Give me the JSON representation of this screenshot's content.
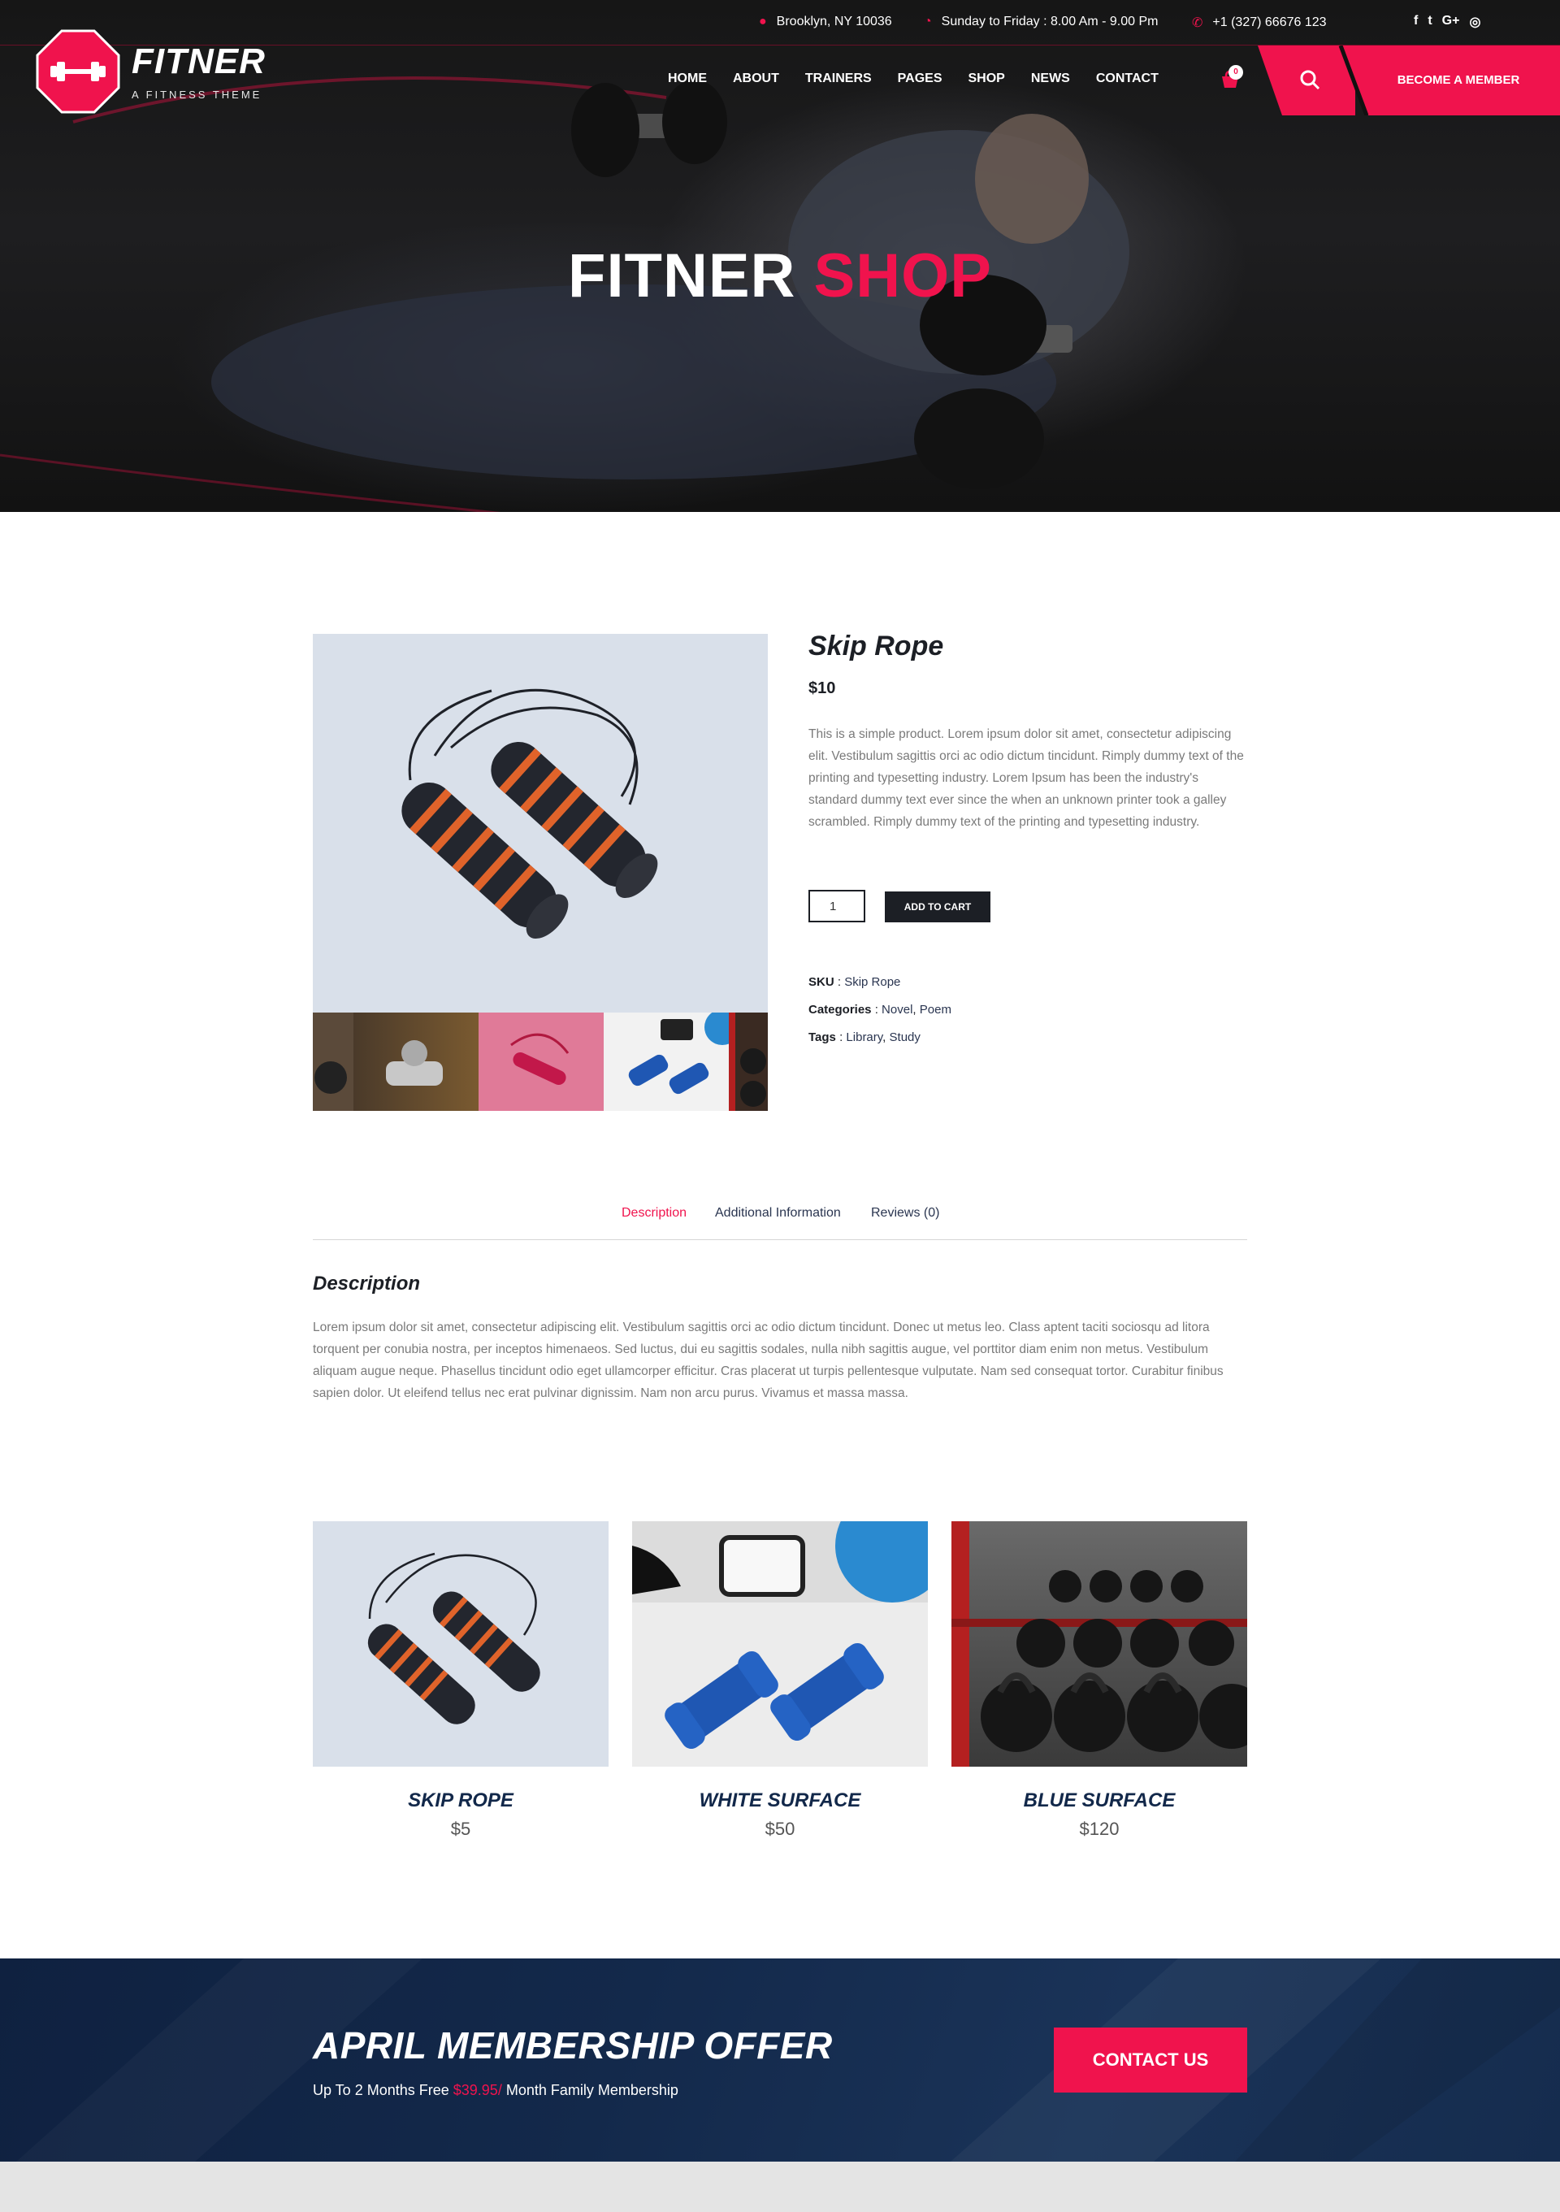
{
  "topbar": {
    "address": "Brooklyn, NY 10036",
    "hours": "Sunday to Friday : 8.00 Am - 9.00 Pm",
    "phone": "+1 (327) 66676 123",
    "social": [
      "facebook-icon",
      "twitter-icon",
      "google-plus-icon",
      "instagram-icon"
    ],
    "social_glyphs": [
      "f",
      "t",
      "G+",
      "◎"
    ]
  },
  "brand": {
    "name": "FITNER",
    "tagline": "A FITNESS THEME",
    "accent_color": "#f0134d"
  },
  "nav": {
    "items": [
      "HOME",
      "ABOUT",
      "TRAINERS",
      "PAGES",
      "SHOP",
      "NEWS",
      "CONTACT"
    ],
    "cart_count": "0",
    "member_button": "BECOME A MEMBER"
  },
  "hero": {
    "title_main": "FITNER",
    "title_accent": "SHOP"
  },
  "product": {
    "title": "Skip Rope",
    "price": "$10",
    "description": "This is a simple product. Lorem ipsum dolor sit amet, consectetur adipiscing elit. Vestibulum sagittis orci ac odio dictum tincidunt. Rimply dummy text of the printing and typesetting industry. Lorem Ipsum has been the industry's standard dummy text ever since the when an unknown printer took a galley scrambled. Rimply dummy text of the printing and typesetting industry.",
    "quantity": "1",
    "add_to_cart": "ADD TO CART",
    "sku_label": "SKU",
    "sku_value": "Skip Rope",
    "categories_label": "Categories",
    "categories": [
      "Novel",
      "Poem"
    ],
    "tags_label": "Tags",
    "tags": [
      "Library",
      "Study"
    ]
  },
  "tabs": {
    "items": [
      "Description",
      "Additional Information",
      "Reviews (0)"
    ],
    "active": "Description"
  },
  "description": {
    "heading": "Description",
    "text": "Lorem ipsum dolor sit amet, consectetur adipiscing elit. Vestibulum sagittis orci ac odio dictum tincidunt. Donec ut metus leo. Class aptent taciti sociosqu ad litora torquent per conubia nostra, per inceptos himenaeos. Sed luctus, dui eu sagittis sodales, nulla nibh sagittis augue, vel porttitor diam enim non metus. Vestibulum aliquam augue neque. Phasellus tincidunt odio eget ullamcorper efficitur. Cras placerat ut turpis pellentesque vulputate. Nam sed consequat tortor. Curabitur finibus sapien dolor. Ut eleifend tellus nec erat pulvinar dignissim. Nam non arcu purus. Vivamus et massa massa."
  },
  "related": [
    {
      "name": "SKIP ROPE",
      "price": "$5"
    },
    {
      "name": "WHITE SURFACE",
      "price": "$50"
    },
    {
      "name": "BLUE SURFACE",
      "price": "$120"
    }
  ],
  "cta": {
    "title": "APRIL MEMBERSHIP OFFER",
    "sub_before": "Up To 2 Months Free",
    "sub_price": "$39.95/",
    "sub_after": "Month Family Membership",
    "button": "CONTACT US"
  }
}
